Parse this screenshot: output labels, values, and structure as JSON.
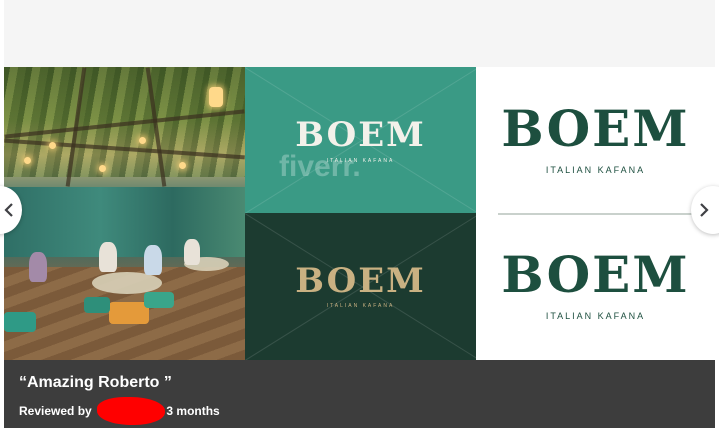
{
  "gallery": {
    "panels": {
      "teal": {
        "logo": "BOEM",
        "tagline": "ITALIAN KAFANA",
        "watermark": "fiverr."
      },
      "dark": {
        "logo": "BOEM",
        "tagline": "ITALIAN KAFANA"
      },
      "white_top": {
        "logo": "BOEM",
        "tagline": "ITALIAN KAFANA"
      },
      "white_bottom": {
        "logo": "BOEM",
        "tagline": "ITALIAN KAFANA"
      }
    },
    "colors": {
      "teal": "#3a9a85",
      "dark_green": "#1c3b30",
      "logo_green": "#1d4f3f",
      "gold": "#c9b182"
    },
    "prev_icon": "chevron-left-icon",
    "next_icon": "chevron-right-icon"
  },
  "review": {
    "quote": "“Amazing Roberto ”",
    "reviewed_by_label": "Reviewed by",
    "time_suffix": "3 months"
  }
}
